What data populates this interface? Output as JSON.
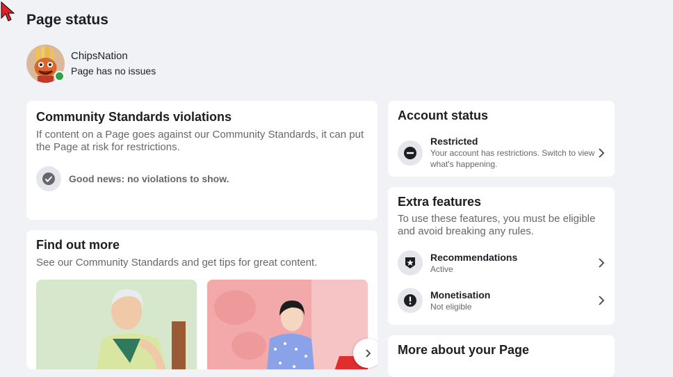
{
  "page": {
    "title": "Page status"
  },
  "profile": {
    "name": "ChipsNation",
    "status": "Page has no issues"
  },
  "violations": {
    "title": "Community Standards violations",
    "description": "If content on a Page goes against our Community Standards, it can put the Page at risk for restrictions.",
    "good_news": "Good news: no violations to show."
  },
  "find_out_more": {
    "title": "Find out more",
    "description": "See our Community Standards and get tips for great content."
  },
  "account_status": {
    "title": "Account status",
    "item": {
      "title": "Restricted",
      "subtitle": "Your account has restrictions. Switch to view what's happening."
    }
  },
  "extra_features": {
    "title": "Extra features",
    "description": "To use these features, you must be eligible and avoid breaking any rules.",
    "items": [
      {
        "title": "Recommendations",
        "subtitle": "Active"
      },
      {
        "title": "Monetisation",
        "subtitle": "Not eligible"
      }
    ]
  },
  "more_about": {
    "title": "More about your Page"
  },
  "colors": {
    "background": "#f0f2f5",
    "card": "#ffffff",
    "online": "#31a24c",
    "cursor": "#e41e26"
  },
  "icons": [
    "cursor-icon",
    "check-circle-icon",
    "minus-circle-icon",
    "shield-star-icon",
    "exclamation-circle-icon",
    "chevron-right-icon"
  ]
}
